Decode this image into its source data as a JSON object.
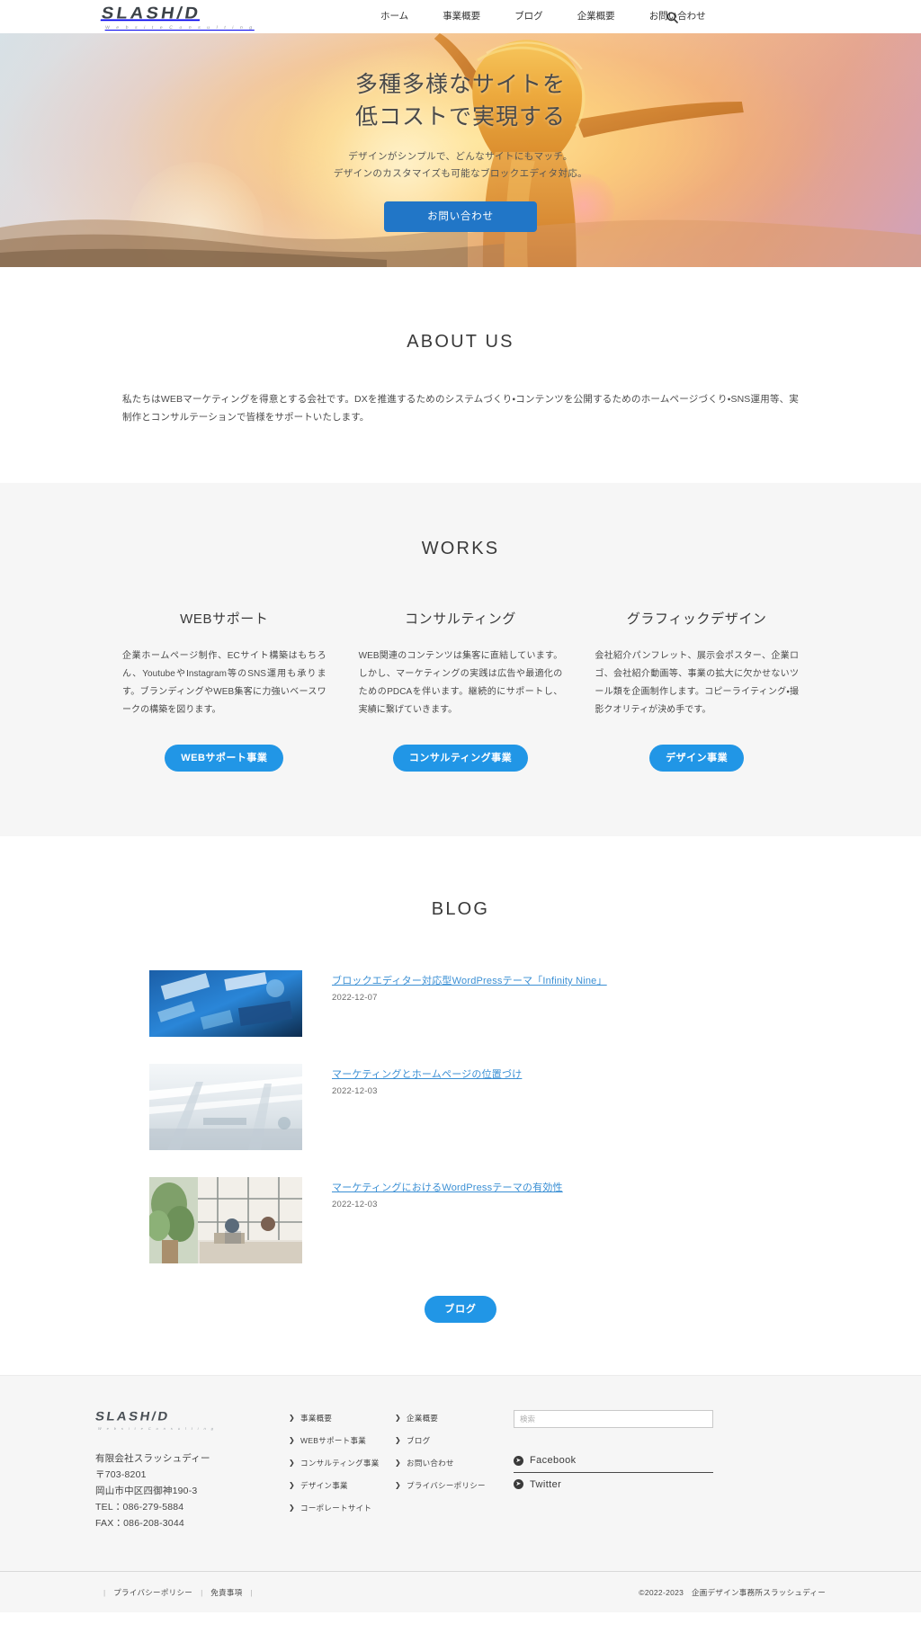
{
  "header": {
    "logo": {
      "main": "SLASH/D",
      "sub": "W e b s i t e   C o n s u l t i n g"
    },
    "nav": [
      {
        "label": "ホーム"
      },
      {
        "label": "事業概要"
      },
      {
        "label": "ブログ"
      },
      {
        "label": "企業概要"
      },
      {
        "label": "お問い合わせ"
      }
    ],
    "search_icon": "search-icon"
  },
  "hero": {
    "title_line1": "多種多様なサイトを",
    "title_line2": "低コストで実現する",
    "sub_line1": "デザインがシンプルで、どんなサイトにもマッチ。",
    "sub_line2": "デザインのカスタマイズも可能なブロックエディタ対応。",
    "cta_label": "お問い合わせ",
    "cta_color": "#2176c7"
  },
  "about": {
    "title": "ABOUT US",
    "body": "私たちはWEBマーケティングを得意とする会社です。DXを推進するためのシステムづくり・コンテンツを公開するためのホームページづくり・SNS運用等、実制作とコンサルテーションで皆様をサポートいたします。"
  },
  "works": {
    "title": "WORKS",
    "accent_color": "#2196e6",
    "columns": [
      {
        "title": "WEBサポート",
        "body": "企業ホームページ制作、ECサイト構築はもちろん、YoutubeやInstagram等のSNS運用も承ります。ブランディングやWEB集客に力強いベースワークの構築を図ります。",
        "button": "WEBサポート事業"
      },
      {
        "title": "コンサルティング",
        "body": "WEB関連のコンテンツは集客に直結しています。しかし、マーケティングの実践は広告や最適化のためのPDCAを伴います。継続的にサポートし、実績に繋げていきます。",
        "button": "コンサルティング事業"
      },
      {
        "title": "グラフィックデザイン",
        "body": "会社紹介パンフレット、展示会ポスター、企業ロゴ、会社紹介動画等、事業の拡大に欠かせないツール類を企画制作します。コピーライティング・撮影クオリティが決め手です。",
        "button": "デザイン事業"
      }
    ]
  },
  "blog": {
    "title": "BLOG",
    "more_label": "ブログ",
    "link_color": "#3a8fd4",
    "posts": [
      {
        "title": "ブロックエディター対応型WordPressテーマ「Infinity Nine」",
        "date": "2022-12-07",
        "thumb": "blue-tech-image"
      },
      {
        "title": "マーケティングとホームページの位置づけ",
        "date": "2022-12-03",
        "thumb": "white-architecture-image"
      },
      {
        "title": "マーケティングにおけるWordPressテーマの有効性",
        "date": "2022-12-03",
        "thumb": "office-meeting-image"
      }
    ]
  },
  "footer": {
    "logo": {
      "main": "SLASH/D",
      "sub": "W e b s i t e   C o n s u l t i n g"
    },
    "company_name": "有限会社スラッシュディー",
    "postal": "〒703-8201",
    "address": "岡山市中区四御神190-3",
    "tel": "TEL：086-279-5884",
    "fax": "FAX：086-208-3044",
    "links_col1": [
      {
        "label": "事業概要"
      },
      {
        "label": "WEBサポート事業"
      },
      {
        "label": "コンサルティング事業"
      },
      {
        "label": "デザイン事業"
      },
      {
        "label": "コーポレートサイト"
      }
    ],
    "links_col2": [
      {
        "label": "企業概要"
      },
      {
        "label": "ブログ"
      },
      {
        "label": "お問い合わせ"
      },
      {
        "label": "プライバシーポリシー"
      }
    ],
    "search_placeholder": "検索",
    "social": [
      {
        "label": "Facebook"
      },
      {
        "label": "Twitter"
      }
    ],
    "bottom_links": [
      {
        "label": "プライバシーポリシー"
      },
      {
        "label": "免責事項"
      }
    ],
    "copyright": "©2022-2023　企画デザイン事務所スラッシュディー"
  }
}
